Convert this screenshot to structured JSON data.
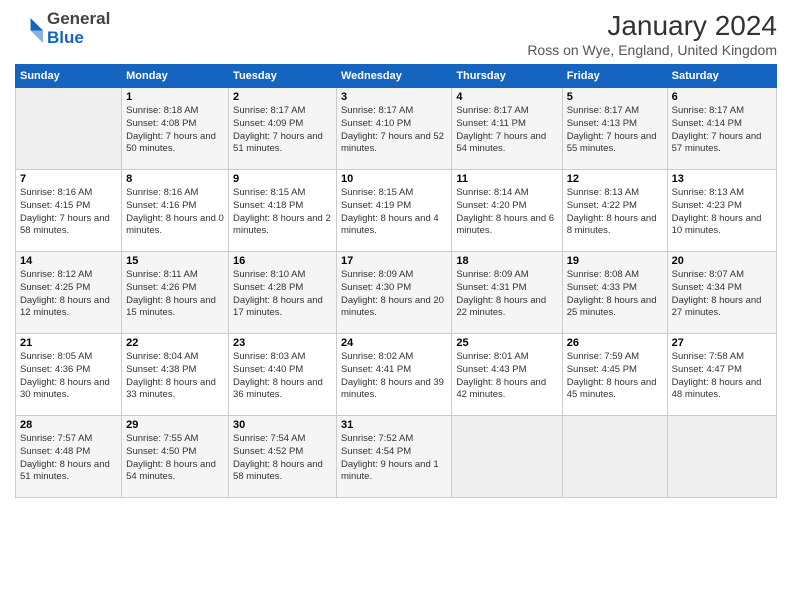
{
  "logo": {
    "general": "General",
    "blue": "Blue"
  },
  "title": "January 2024",
  "subtitle": "Ross on Wye, England, United Kingdom",
  "header_days": [
    "Sunday",
    "Monday",
    "Tuesday",
    "Wednesday",
    "Thursday",
    "Friday",
    "Saturday"
  ],
  "weeks": [
    [
      {
        "day": "",
        "sunrise": "",
        "sunset": "",
        "daylight": ""
      },
      {
        "day": "1",
        "sunrise": "Sunrise: 8:18 AM",
        "sunset": "Sunset: 4:08 PM",
        "daylight": "Daylight: 7 hours and 50 minutes."
      },
      {
        "day": "2",
        "sunrise": "Sunrise: 8:17 AM",
        "sunset": "Sunset: 4:09 PM",
        "daylight": "Daylight: 7 hours and 51 minutes."
      },
      {
        "day": "3",
        "sunrise": "Sunrise: 8:17 AM",
        "sunset": "Sunset: 4:10 PM",
        "daylight": "Daylight: 7 hours and 52 minutes."
      },
      {
        "day": "4",
        "sunrise": "Sunrise: 8:17 AM",
        "sunset": "Sunset: 4:11 PM",
        "daylight": "Daylight: 7 hours and 54 minutes."
      },
      {
        "day": "5",
        "sunrise": "Sunrise: 8:17 AM",
        "sunset": "Sunset: 4:13 PM",
        "daylight": "Daylight: 7 hours and 55 minutes."
      },
      {
        "day": "6",
        "sunrise": "Sunrise: 8:17 AM",
        "sunset": "Sunset: 4:14 PM",
        "daylight": "Daylight: 7 hours and 57 minutes."
      }
    ],
    [
      {
        "day": "7",
        "sunrise": "Sunrise: 8:16 AM",
        "sunset": "Sunset: 4:15 PM",
        "daylight": "Daylight: 7 hours and 58 minutes."
      },
      {
        "day": "8",
        "sunrise": "Sunrise: 8:16 AM",
        "sunset": "Sunset: 4:16 PM",
        "daylight": "Daylight: 8 hours and 0 minutes."
      },
      {
        "day": "9",
        "sunrise": "Sunrise: 8:15 AM",
        "sunset": "Sunset: 4:18 PM",
        "daylight": "Daylight: 8 hours and 2 minutes."
      },
      {
        "day": "10",
        "sunrise": "Sunrise: 8:15 AM",
        "sunset": "Sunset: 4:19 PM",
        "daylight": "Daylight: 8 hours and 4 minutes."
      },
      {
        "day": "11",
        "sunrise": "Sunrise: 8:14 AM",
        "sunset": "Sunset: 4:20 PM",
        "daylight": "Daylight: 8 hours and 6 minutes."
      },
      {
        "day": "12",
        "sunrise": "Sunrise: 8:13 AM",
        "sunset": "Sunset: 4:22 PM",
        "daylight": "Daylight: 8 hours and 8 minutes."
      },
      {
        "day": "13",
        "sunrise": "Sunrise: 8:13 AM",
        "sunset": "Sunset: 4:23 PM",
        "daylight": "Daylight: 8 hours and 10 minutes."
      }
    ],
    [
      {
        "day": "14",
        "sunrise": "Sunrise: 8:12 AM",
        "sunset": "Sunset: 4:25 PM",
        "daylight": "Daylight: 8 hours and 12 minutes."
      },
      {
        "day": "15",
        "sunrise": "Sunrise: 8:11 AM",
        "sunset": "Sunset: 4:26 PM",
        "daylight": "Daylight: 8 hours and 15 minutes."
      },
      {
        "day": "16",
        "sunrise": "Sunrise: 8:10 AM",
        "sunset": "Sunset: 4:28 PM",
        "daylight": "Daylight: 8 hours and 17 minutes."
      },
      {
        "day": "17",
        "sunrise": "Sunrise: 8:09 AM",
        "sunset": "Sunset: 4:30 PM",
        "daylight": "Daylight: 8 hours and 20 minutes."
      },
      {
        "day": "18",
        "sunrise": "Sunrise: 8:09 AM",
        "sunset": "Sunset: 4:31 PM",
        "daylight": "Daylight: 8 hours and 22 minutes."
      },
      {
        "day": "19",
        "sunrise": "Sunrise: 8:08 AM",
        "sunset": "Sunset: 4:33 PM",
        "daylight": "Daylight: 8 hours and 25 minutes."
      },
      {
        "day": "20",
        "sunrise": "Sunrise: 8:07 AM",
        "sunset": "Sunset: 4:34 PM",
        "daylight": "Daylight: 8 hours and 27 minutes."
      }
    ],
    [
      {
        "day": "21",
        "sunrise": "Sunrise: 8:05 AM",
        "sunset": "Sunset: 4:36 PM",
        "daylight": "Daylight: 8 hours and 30 minutes."
      },
      {
        "day": "22",
        "sunrise": "Sunrise: 8:04 AM",
        "sunset": "Sunset: 4:38 PM",
        "daylight": "Daylight: 8 hours and 33 minutes."
      },
      {
        "day": "23",
        "sunrise": "Sunrise: 8:03 AM",
        "sunset": "Sunset: 4:40 PM",
        "daylight": "Daylight: 8 hours and 36 minutes."
      },
      {
        "day": "24",
        "sunrise": "Sunrise: 8:02 AM",
        "sunset": "Sunset: 4:41 PM",
        "daylight": "Daylight: 8 hours and 39 minutes."
      },
      {
        "day": "25",
        "sunrise": "Sunrise: 8:01 AM",
        "sunset": "Sunset: 4:43 PM",
        "daylight": "Daylight: 8 hours and 42 minutes."
      },
      {
        "day": "26",
        "sunrise": "Sunrise: 7:59 AM",
        "sunset": "Sunset: 4:45 PM",
        "daylight": "Daylight: 8 hours and 45 minutes."
      },
      {
        "day": "27",
        "sunrise": "Sunrise: 7:58 AM",
        "sunset": "Sunset: 4:47 PM",
        "daylight": "Daylight: 8 hours and 48 minutes."
      }
    ],
    [
      {
        "day": "28",
        "sunrise": "Sunrise: 7:57 AM",
        "sunset": "Sunset: 4:48 PM",
        "daylight": "Daylight: 8 hours and 51 minutes."
      },
      {
        "day": "29",
        "sunrise": "Sunrise: 7:55 AM",
        "sunset": "Sunset: 4:50 PM",
        "daylight": "Daylight: 8 hours and 54 minutes."
      },
      {
        "day": "30",
        "sunrise": "Sunrise: 7:54 AM",
        "sunset": "Sunset: 4:52 PM",
        "daylight": "Daylight: 8 hours and 58 minutes."
      },
      {
        "day": "31",
        "sunrise": "Sunrise: 7:52 AM",
        "sunset": "Sunset: 4:54 PM",
        "daylight": "Daylight: 9 hours and 1 minute."
      },
      {
        "day": "",
        "sunrise": "",
        "sunset": "",
        "daylight": ""
      },
      {
        "day": "",
        "sunrise": "",
        "sunset": "",
        "daylight": ""
      },
      {
        "day": "",
        "sunrise": "",
        "sunset": "",
        "daylight": ""
      }
    ]
  ],
  "colors": {
    "header_bg": "#1565c0",
    "header_text": "#ffffff",
    "odd_row": "#f5f5f5",
    "even_row": "#ffffff"
  }
}
